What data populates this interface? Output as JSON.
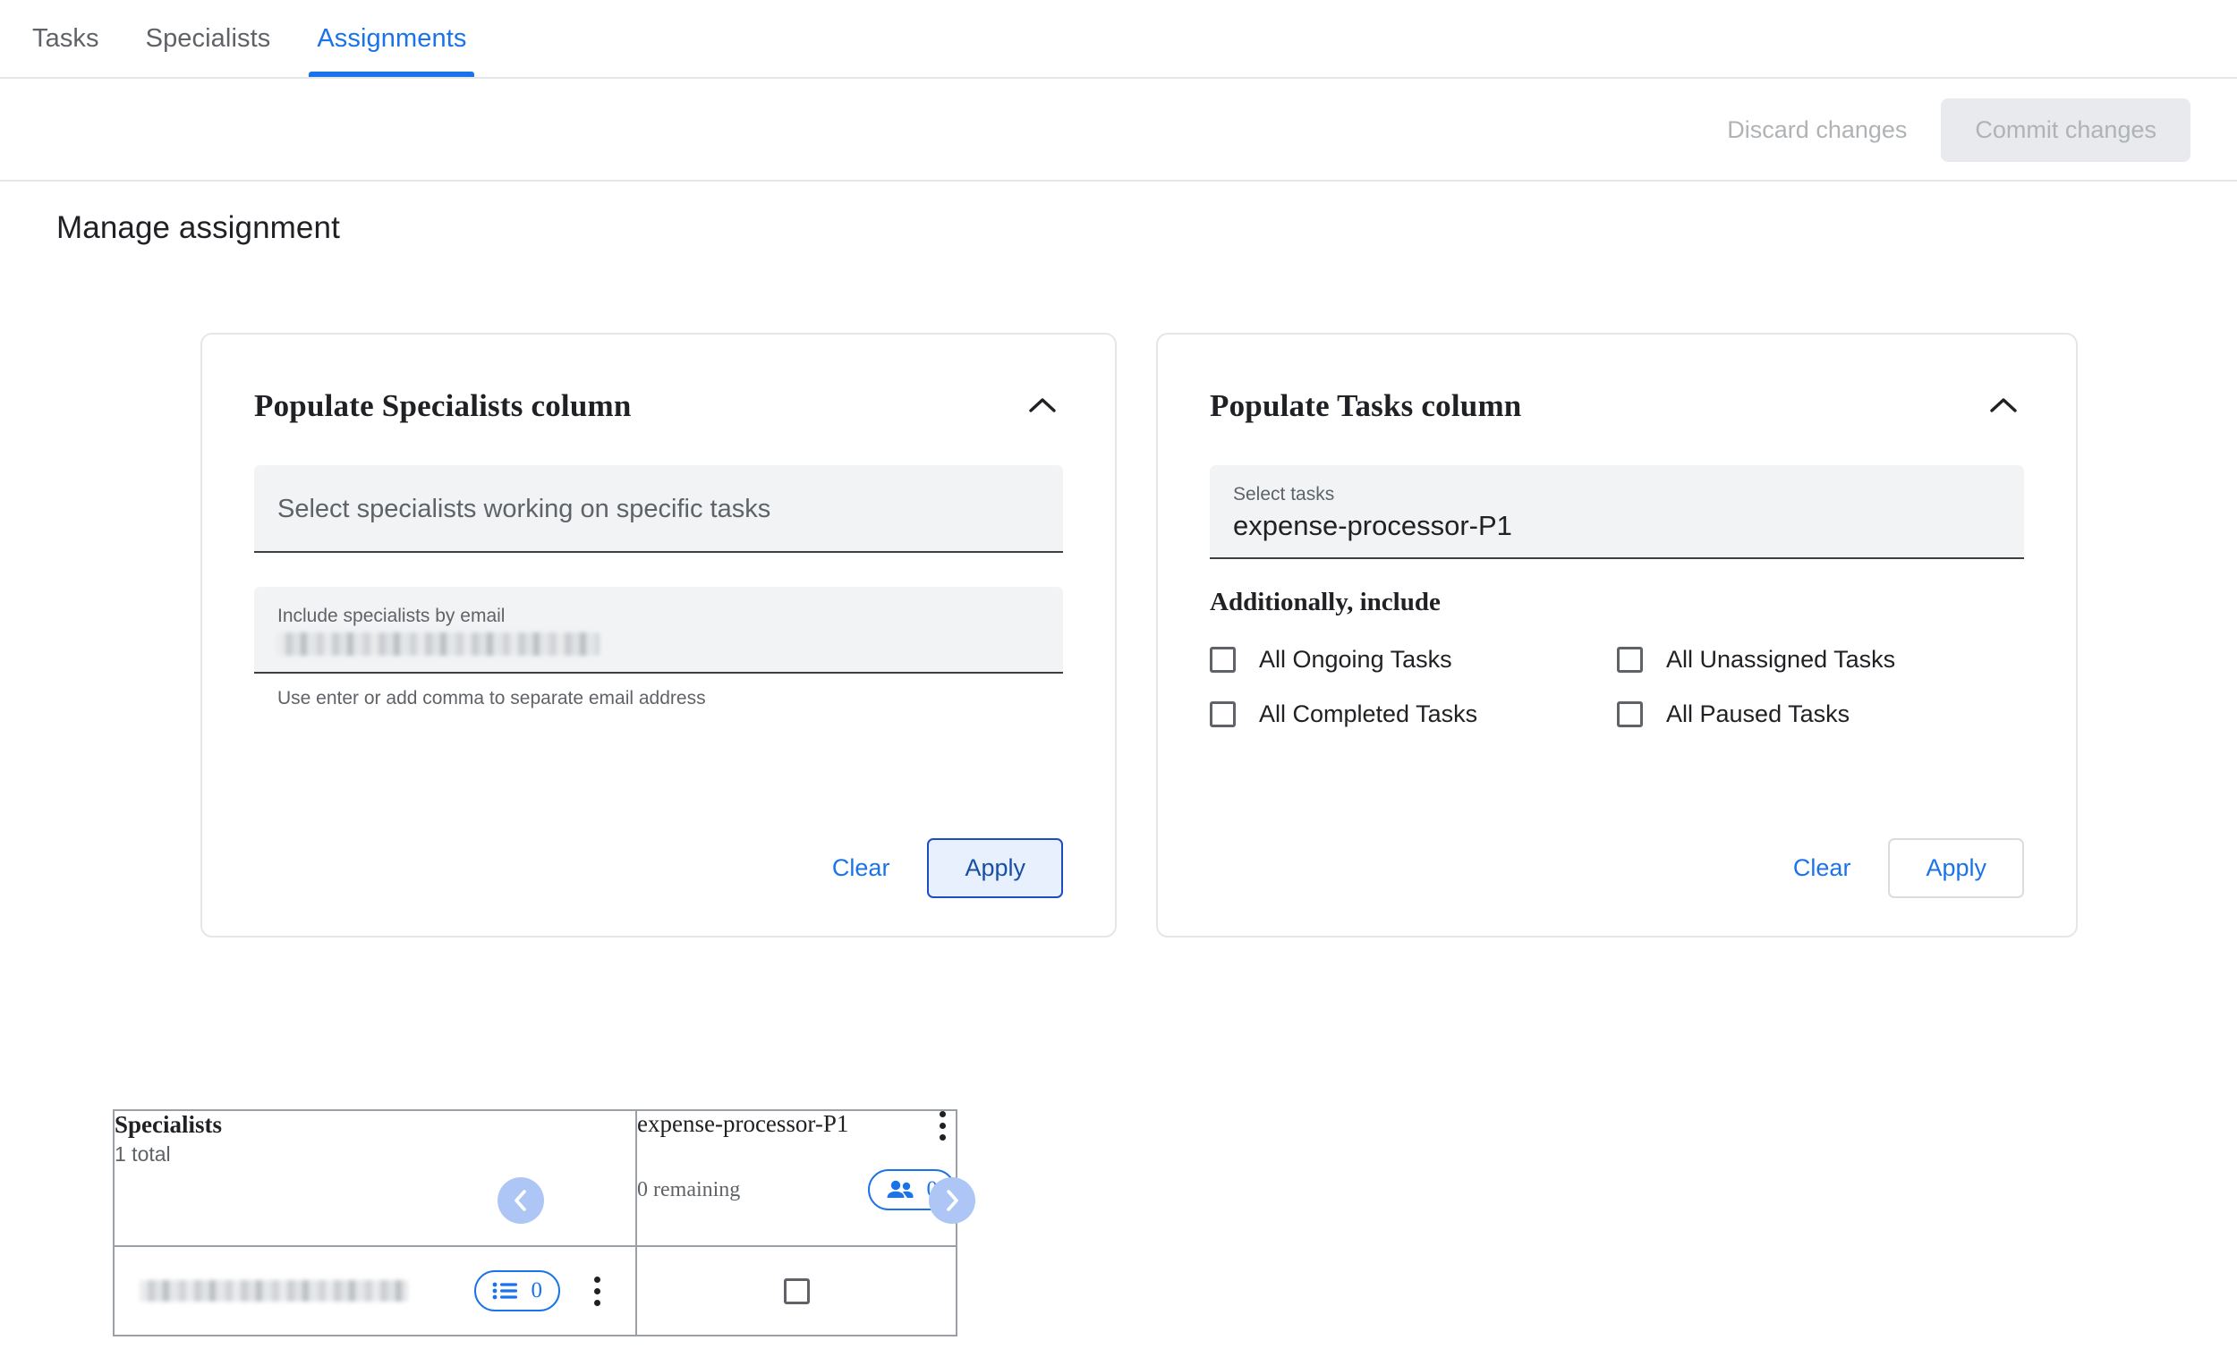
{
  "tabs": [
    {
      "label": "Tasks",
      "active": false
    },
    {
      "label": "Specialists",
      "active": false
    },
    {
      "label": "Assignments",
      "active": true
    }
  ],
  "actionbar": {
    "discard_label": "Discard changes",
    "commit_label": "Commit changes"
  },
  "page_title": "Manage assignment",
  "cards": {
    "specialists": {
      "title": "Populate Specialists column",
      "collapse_icon": "chevron-up-icon",
      "select_placeholder": "Select specialists working on specific tasks",
      "email_label": "Include specialists by email",
      "email_value": "",
      "email_hint": "Use enter or add comma to separate email address",
      "clear_label": "Clear",
      "apply_label": "Apply"
    },
    "tasks": {
      "title": "Populate Tasks column",
      "collapse_icon": "chevron-up-icon",
      "select_label": "Select tasks",
      "select_value": "expense-processor-P1",
      "additional_heading": "Additionally, include",
      "checkboxes": [
        {
          "label": "All Ongoing Tasks",
          "checked": false
        },
        {
          "label": "All Unassigned Tasks",
          "checked": false
        },
        {
          "label": "All Completed Tasks",
          "checked": false
        },
        {
          "label": "All Paused Tasks",
          "checked": false
        }
      ],
      "clear_label": "Clear",
      "apply_label": "Apply"
    }
  },
  "grid": {
    "specialists_header": {
      "title": "Specialists",
      "subtitle": "1 total"
    },
    "task_header": {
      "title": "expense-processor-P1",
      "remaining": "0 remaining",
      "assigned_count": "0",
      "menu_icon": "more-vert-icon",
      "people_icon": "people-icon"
    },
    "rows": [
      {
        "email": "",
        "list_count": "0",
        "list_icon": "list-icon",
        "menu_icon": "more-vert-icon",
        "task_checked": false
      }
    ],
    "nav": {
      "prev_icon": "chevron-left-icon",
      "next_icon": "chevron-right-icon"
    }
  },
  "colors": {
    "accent": "#1a73e8",
    "nav_button": "#aec6f5",
    "field_bg": "#f1f3f4",
    "border": "#e4e6e8",
    "grid_border": "#9aa0a6",
    "muted_text": "#5f6368",
    "disabled_text": "#b0b3b6",
    "commit_bg": "#e8eaed",
    "apply_focus_bg": "#e8f0fe"
  }
}
